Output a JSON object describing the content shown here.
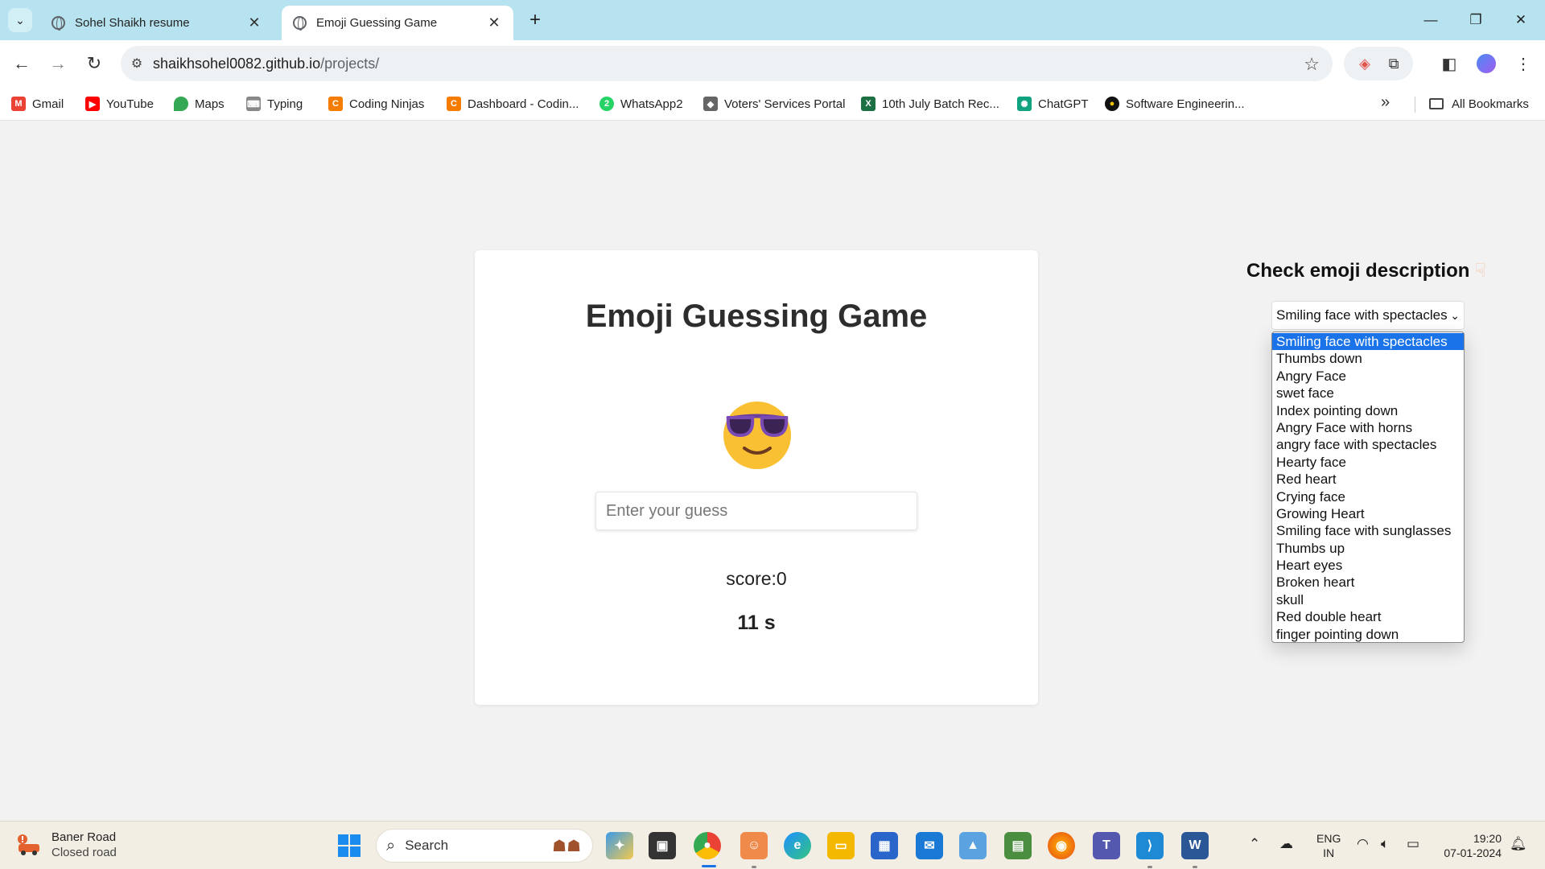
{
  "browser": {
    "tabs": [
      {
        "title": "Sohel Shaikh resume",
        "active": false
      },
      {
        "title": "Emoji Guessing Game",
        "active": true
      }
    ],
    "url_host": "shaikhsohel0082.github.io",
    "url_path": "/projects/",
    "bookmarks": [
      {
        "label": "Gmail",
        "icon": "gmail-icon",
        "color": "#ea4335"
      },
      {
        "label": "YouTube",
        "icon": "youtube-icon",
        "color": "#ff0000"
      },
      {
        "label": "Maps",
        "icon": "maps-icon",
        "color": "#34a853"
      },
      {
        "label": "Typing",
        "icon": "typing-icon",
        "color": "#777777"
      },
      {
        "label": "Coding Ninjas",
        "icon": "coding-ninjas-icon",
        "color": "#f57c00"
      },
      {
        "label": "Dashboard - Codin...",
        "icon": "coding-ninjas-icon",
        "color": "#f57c00"
      },
      {
        "label": "WhatsApp2",
        "icon": "whatsapp-icon",
        "color": "#25d366"
      },
      {
        "label": "Voters' Services Portal",
        "icon": "voters-portal-icon",
        "color": "#555555"
      },
      {
        "label": "10th July Batch Rec...",
        "icon": "excel-icon",
        "color": "#1d7044"
      },
      {
        "label": "ChatGPT",
        "icon": "chatgpt-icon",
        "color": "#10a37f"
      },
      {
        "label": "Software Engineerin...",
        "icon": "software-eng-icon",
        "color": "#111111"
      }
    ],
    "all_bookmarks_label": "All Bookmarks"
  },
  "game": {
    "title": "Emoji Guessing Game",
    "current_emoji": "smiling-face-with-sunglasses",
    "input_placeholder": "Enter your guess",
    "input_value": "",
    "score_text": "score:0",
    "timer_text": "11 s"
  },
  "description": {
    "heading": "Check emoji description",
    "selected": "Smiling face with spectacles",
    "options": [
      "Smiling face with spectacles",
      "Thumbs down",
      "Angry Face",
      "swet face",
      "Index pointing down",
      "Angry Face with horns",
      "angry face with spectacles",
      "Hearty face",
      "Red heart",
      "Crying face",
      "Growing Heart",
      "Smiling face with sunglasses",
      "Thumbs up",
      "Heart eyes",
      "Broken heart",
      "skull",
      "Red double heart",
      "finger pointing down"
    ]
  },
  "taskbar": {
    "weather_title": "Baner Road",
    "weather_sub": "Closed road",
    "search_label": "Search",
    "lang_line1": "ENG",
    "lang_line2": "IN",
    "time": "19:20",
    "date": "07-01-2024"
  }
}
